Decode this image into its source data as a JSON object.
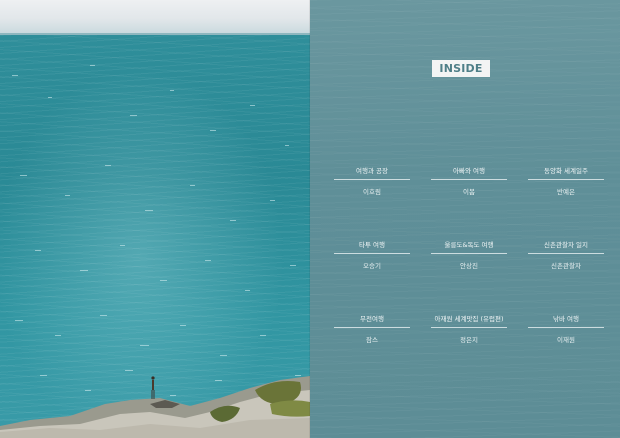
{
  "contents": {
    "heading": "INSIDE",
    "rows": [
      [
        {
          "title": "여행과 공장",
          "author": "이호림"
        },
        {
          "title": "아빠와 여행",
          "author": "이봄"
        },
        {
          "title": "동양화 세계일주",
          "author": "반예은"
        }
      ],
      [
        {
          "title": "타투 여행",
          "author": "오승기"
        },
        {
          "title": "울릉도&독도 여행",
          "author": "안상진"
        },
        {
          "title": "신촌관찰자 일지",
          "author": "신촌관찰자"
        }
      ],
      [
        {
          "title": "무전여행",
          "author": "잠스"
        },
        {
          "title": "아재원 세계맛집 (유럽편)",
          "author": "정은지"
        },
        {
          "title": "낚바 여행",
          "author": "이재원"
        }
      ]
    ]
  },
  "colors": {
    "sea": "#2f8e9a",
    "page_tint": "#5f8f98",
    "label_bg": "#f3f4f4"
  }
}
